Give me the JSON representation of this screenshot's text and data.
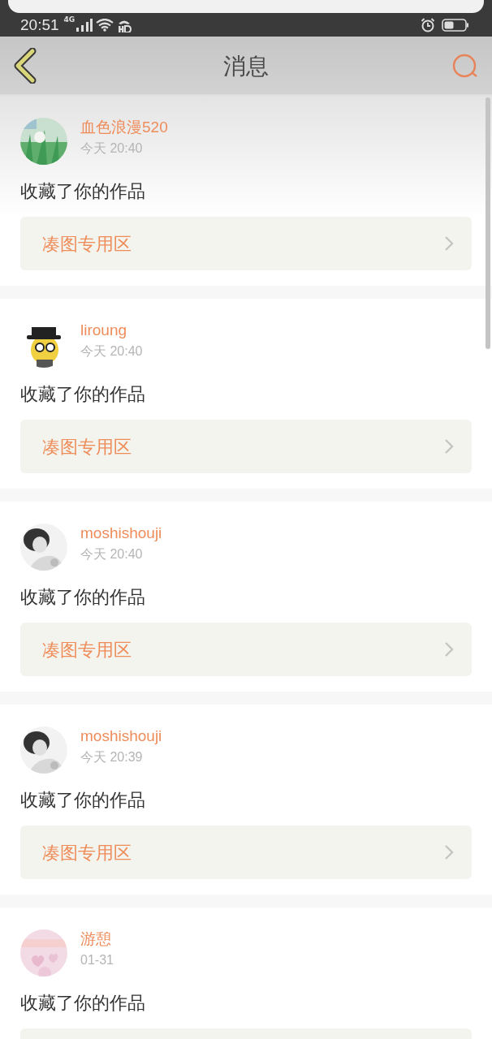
{
  "status_bar": {
    "time": "20:51",
    "network": "4G"
  },
  "header": {
    "title": "消息"
  },
  "messages": [
    {
      "user": "血色浪漫520",
      "time": "今天 20:40",
      "text": "收藏了你的作品",
      "link": "凑图专用区"
    },
    {
      "user": "liroung",
      "time": "今天 20:40",
      "text": "收藏了你的作品",
      "link": "凑图专用区"
    },
    {
      "user": "moshishouji",
      "time": "今天 20:40",
      "text": "收藏了你的作品",
      "link": "凑图专用区"
    },
    {
      "user": "moshishouji",
      "time": "今天 20:39",
      "text": "收藏了你的作品",
      "link": "凑图专用区"
    },
    {
      "user": "游憩",
      "time": "01-31",
      "text": "收藏了你的作品"
    }
  ]
}
